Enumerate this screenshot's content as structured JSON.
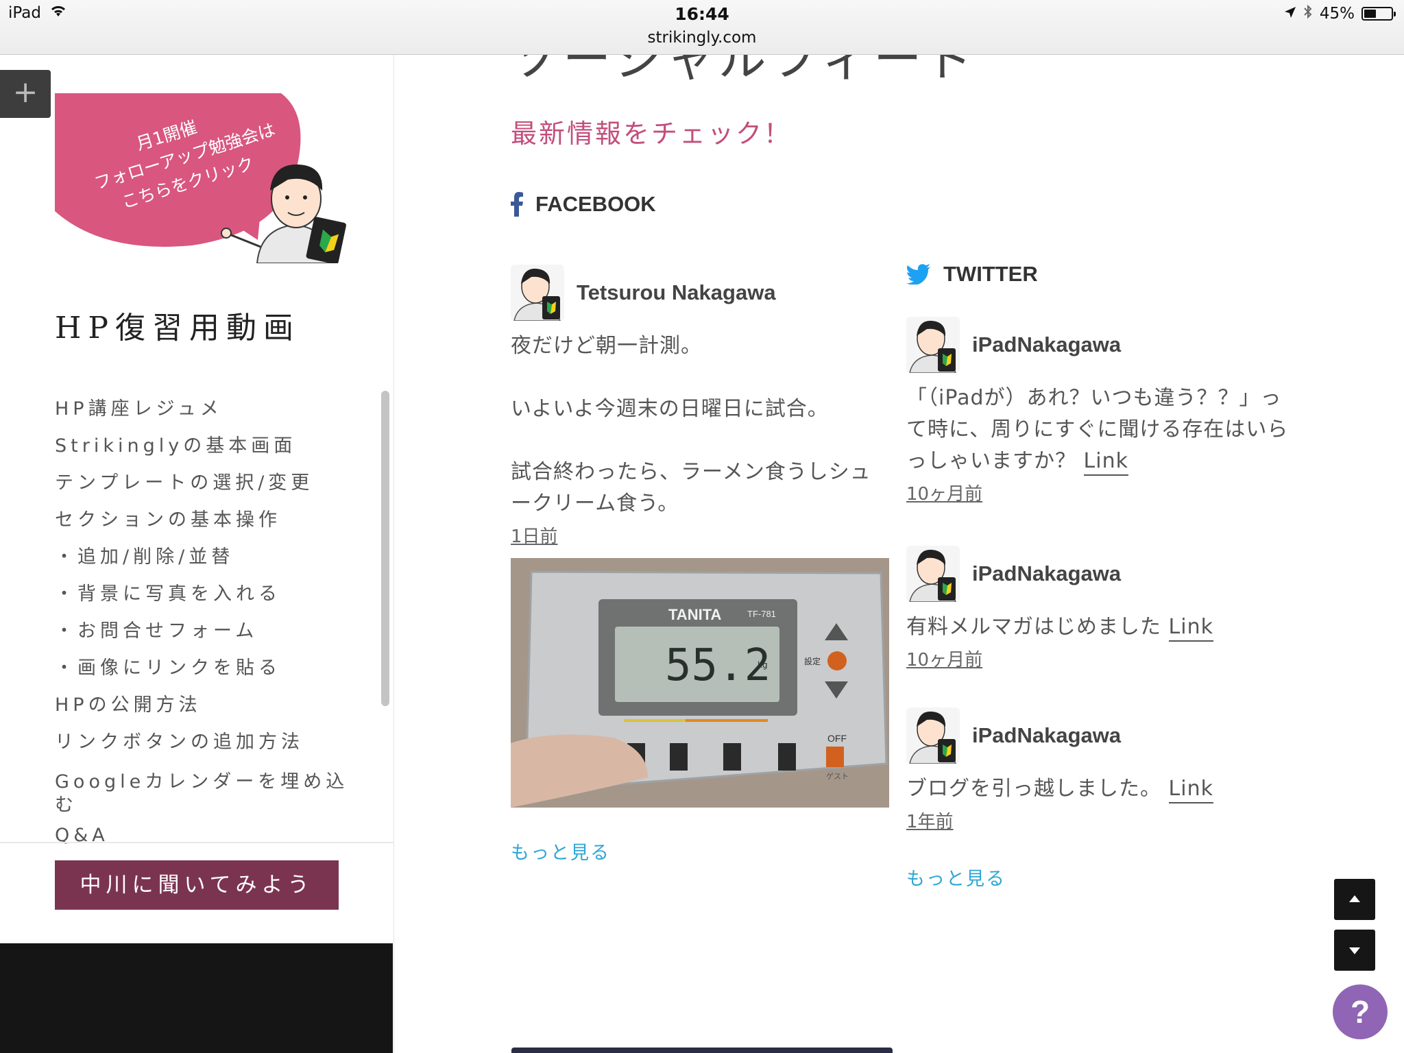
{
  "status": {
    "device": "iPad",
    "time": "16:44",
    "url": "strikingly.com",
    "battery": "45%",
    "battery_level": 0.45
  },
  "sidebar": {
    "banner_text": [
      "月1開催",
      "フォローアップ勉強会は",
      "こちらをクリック"
    ],
    "title": "HP復習用動画",
    "nav_items": [
      "HP講座レジュメ",
      "Strikinglyの基本画面",
      "テンプレートの選択/変更",
      "セクションの基本操作",
      "・追加/削除/並替",
      "・背景に写真を入れる",
      "・お問合せフォーム",
      "・画像にリンクを貼る",
      "HPの公開方法",
      "リンクボタンの追加方法",
      "Googleカレンダーを埋め込む",
      "Q&A"
    ],
    "ask_button": "中川に聞いてみよう"
  },
  "main": {
    "heading": "ソーシャルフィード",
    "subheading": "最新情報をチェック！",
    "facebook": {
      "label": "FACEBOOK",
      "author": "Tetsurou Nakagawa",
      "text": [
        "夜だけど朝一計測。",
        "いよいよ今週末の日曜日に試合。",
        "試合終わったら、ラーメン食うしシュークリーム食う。"
      ],
      "time": "1日前",
      "photo": {
        "brand": "TANITA",
        "model": "TF-781",
        "reading": "55.2",
        "unit": "kg",
        "setting_label": "設定",
        "off_label": "OFF",
        "guest_label": "ゲスト"
      },
      "more": "もっと見る"
    },
    "twitter": {
      "label": "TWITTER",
      "tweets": [
        {
          "author": "iPadNakagawa",
          "text": "「（iPadが）あれ？いつも違う？？」って時に、周りにすぐに聞ける存在はいらっしゃいますか？",
          "link": "Link",
          "time": "10ヶ月前"
        },
        {
          "author": "iPadNakagawa",
          "text": "有料メルマガはじめました",
          "link": "Link",
          "time": "10ヶ月前"
        },
        {
          "author": "iPadNakagawa",
          "text": "ブログを引っ越しました。",
          "link": "Link",
          "time": "1年前"
        }
      ],
      "more": "もっと見る"
    }
  },
  "help": "?",
  "colors": {
    "accent_pink": "#c24f7b",
    "button_wine": "#7b3450",
    "link_blue": "#2ea6d6",
    "help_purple": "#9065b5"
  }
}
